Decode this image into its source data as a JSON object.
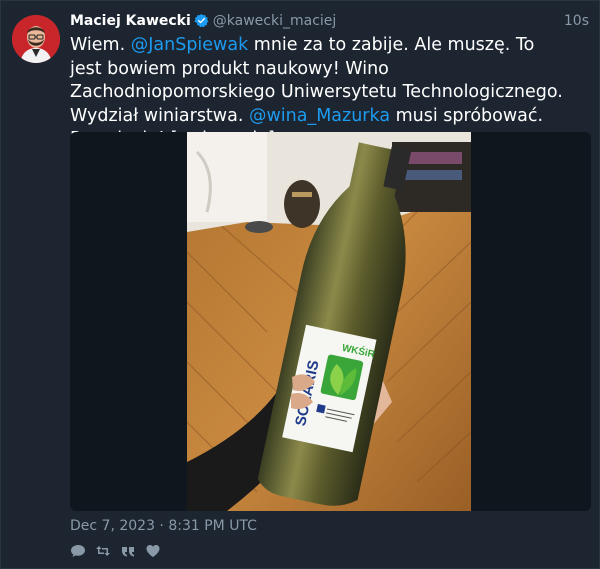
{
  "tweet": {
    "author_name": "Maciej Kawecki",
    "author_handle": "@kawecki_maciej",
    "time_ago": "10s",
    "verified": true,
    "text_parts": [
      {
        "text": "Wiem. ",
        "mention": false
      },
      {
        "text": "@JanSpiewak",
        "mention": true
      },
      {
        "text": " mnie za to zabije. Ale muszę. To jest bowiem produkt naukowy! Wino Zachodniopomorskiego Uniwersytetu Technologicznego. Wydział winiarstwa. ",
        "mention": false
      },
      {
        "text": "@wina_Mazurka",
        "mention": true
      },
      {
        "text": " musi spróbować. Rewelacja! [wybaczcie]",
        "mention": false
      }
    ],
    "date": "Dec 7, 2023 · 8:31 PM UTC",
    "media": {
      "label_brand": "SOLARIS",
      "label_dept": "WKŚiR"
    }
  },
  "actions": {
    "reply_icon": "comment-icon",
    "retweet_icon": "retweet-icon",
    "quote_icon": "quote-icon",
    "like_icon": "heart-icon"
  },
  "colors": {
    "background": "#1c2530",
    "mention": "#1d9bf0",
    "muted": "#8a99a8",
    "verified": "#1d9bf0"
  }
}
